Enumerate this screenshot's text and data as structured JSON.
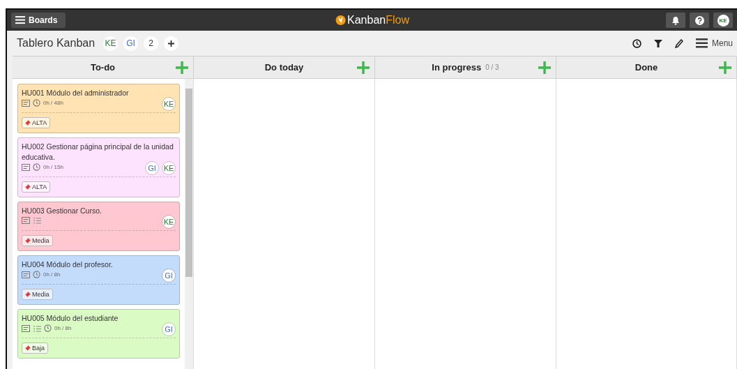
{
  "topbar": {
    "boards_label": "Boards",
    "logo_left": "Kanban",
    "logo_right": "Flow",
    "user": {
      "initials": "KE",
      "color": "#2e7d32"
    }
  },
  "board": {
    "title": "Tablero Kanban",
    "members": [
      {
        "initials": "KE",
        "color": "#2e7d32"
      },
      {
        "initials": "GI",
        "color": "#3a6fd8"
      }
    ],
    "more_count": "2",
    "menu_label": "Menu"
  },
  "columns": [
    {
      "title": "To-do",
      "cards": [
        {
          "title": "HU001 Módulo del administrador",
          "color": "#ffe3b3",
          "checklist": false,
          "time": "0h / 48h",
          "assignees": [
            {
              "initials": "KE",
              "color": "#2e7d32"
            }
          ],
          "tag": "ALTA"
        },
        {
          "title": "HU002 Gestionar página principal de la unidad educativa.",
          "color": "#fde3fd",
          "checklist": false,
          "time": "0h / 15h",
          "assignees": [
            {
              "initials": "GI",
              "color": "#3a6fd8"
            },
            {
              "initials": "KE",
              "color": "#2e7d32"
            }
          ],
          "tag": "ALTA"
        },
        {
          "title": "HU003 Gestionar Curso.",
          "color": "#ffc8d0",
          "checklist": true,
          "assignees": [
            {
              "initials": "KE",
              "color": "#2e7d32"
            }
          ],
          "tag": "Media"
        },
        {
          "title": "HU004 Módulo del profesor.",
          "color": "#c3dcfb",
          "checklist": false,
          "time": "0h / 8h",
          "assignees": [
            {
              "initials": "GI",
              "color": "#3a6fd8"
            }
          ],
          "tag": "Media"
        },
        {
          "title": "HU005 Módulo del estudiante",
          "color": "#dbfbc4",
          "checklist": true,
          "time": "0h / 8h",
          "assignees": [
            {
              "initials": "GI",
              "color": "#3a6fd8"
            }
          ],
          "tag": "Baja"
        }
      ]
    },
    {
      "title": "Do today"
    },
    {
      "title": "In progress",
      "limit": "0 / 3"
    },
    {
      "title": "Done"
    }
  ]
}
